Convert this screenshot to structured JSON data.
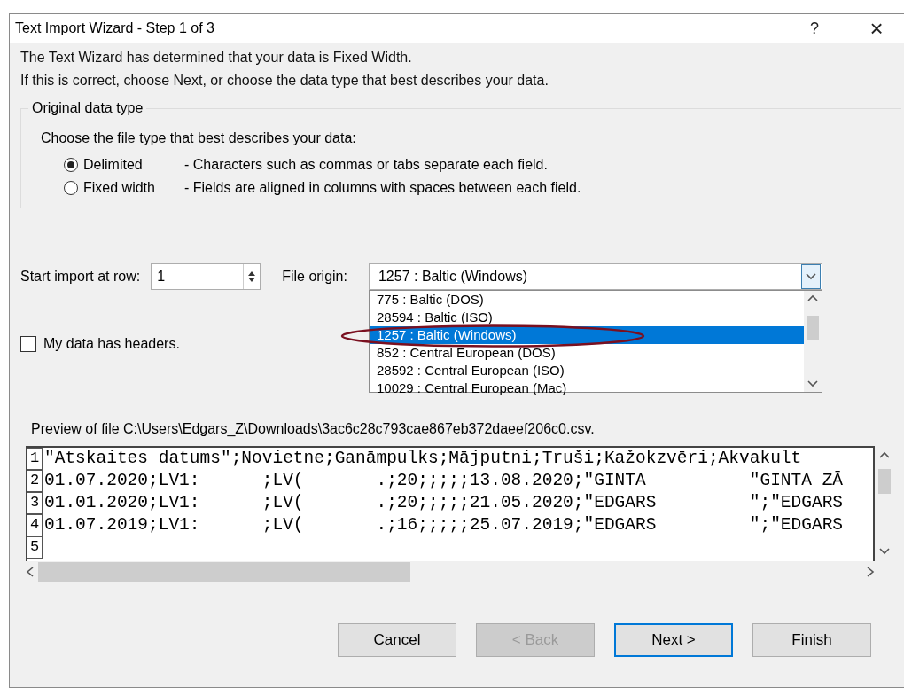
{
  "window": {
    "title": "Text Import Wizard - Step 1 of 3",
    "help": "?",
    "close": "×"
  },
  "intro": [
    "The Text Wizard has determined that your data is Fixed Width.",
    "If this is correct, choose Next, or choose the data type that best describes your data."
  ],
  "group": {
    "title": "Original data type",
    "prompt": "Choose the file type that best describes your data:",
    "options": [
      {
        "label": "Delimited",
        "description": "- Characters such as commas or tabs separate each field.",
        "selected": true
      },
      {
        "label": "Fixed width",
        "description": "- Fields are aligned in columns with spaces between each field.",
        "selected": false
      }
    ]
  },
  "start_row": {
    "label": "Start import at row:",
    "value": "1"
  },
  "file_origin": {
    "label": "File origin:",
    "value": "1257 : Baltic (Windows)",
    "options": [
      {
        "label": "775 : Baltic (DOS)",
        "selected": false
      },
      {
        "label": "28594 : Baltic (ISO)",
        "selected": false
      },
      {
        "label": "1257 : Baltic (Windows)",
        "selected": true
      },
      {
        "label": "852 : Central European (DOS)",
        "selected": false
      },
      {
        "label": "28592 : Central European (ISO)",
        "selected": false
      },
      {
        "label": "10029 : Central European (Mac)",
        "selected": false
      }
    ]
  },
  "headers": {
    "label": "My data has headers.",
    "checked": false
  },
  "preview": {
    "label": "Preview of file C:\\Users\\Edgars_Z\\Downloads\\3ac6c28c793cae867eb372daeef206c0.csv.",
    "rows": [
      {
        "number": "1",
        "text": "\"Atskaites datums\";Novietne;Ganāmpulks;Mājputni;Truši;Kažokzvēri;Akvakult"
      },
      {
        "number": "2",
        "text": "01.07.2020;LV1:      ;LV(       .;20;;;;;13.08.2020;\"GINTA          \"GINTA ZĀ"
      },
      {
        "number": "3",
        "text": "01.01.2020;LV1:      ;LV(       .;20;;;;;21.05.2020;\"EDGARS         \";\"EDGARS"
      },
      {
        "number": "4",
        "text": "01.07.2019;LV1:      ;LV(       .;16;;;;;25.07.2019;\"EDGARS         \";\"EDGARS"
      },
      {
        "number": "5",
        "text": ""
      }
    ]
  },
  "buttons": [
    {
      "label": "Cancel",
      "disabled": false,
      "default": false
    },
    {
      "label": "< Back",
      "disabled": true,
      "default": false
    },
    {
      "label": "Next >",
      "disabled": false,
      "default": true
    },
    {
      "label": "Finish",
      "disabled": false,
      "default": false
    }
  ]
}
